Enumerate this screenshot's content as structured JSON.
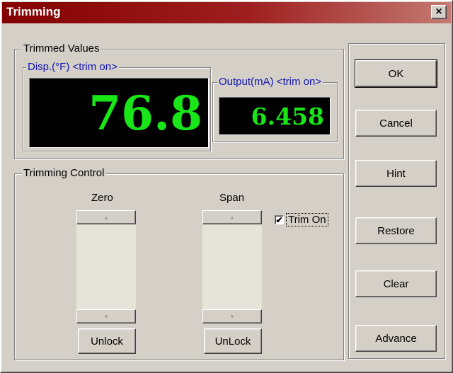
{
  "window": {
    "title": "Trimming",
    "close_glyph": "×"
  },
  "trimmed_values": {
    "legend": "Trimmed Values",
    "disp": {
      "legend": "Disp.(°F) <trim on>",
      "value": "76.8"
    },
    "output": {
      "legend": "Output(mA) <trim on>",
      "value": "6.458"
    }
  },
  "trimming_control": {
    "legend": "Trimming Control",
    "zero": {
      "label": "Zero",
      "unlock_label": "Unlock"
    },
    "span": {
      "label": "Span",
      "unlock_label": "UnLock"
    },
    "trim_on": {
      "label": "Trim On",
      "checked": true,
      "check_glyph": "✔"
    },
    "scroll_up_glyph": "▲",
    "scroll_down_glyph": "▼"
  },
  "buttons": {
    "ok": "OK",
    "cancel": "Cancel",
    "hint": "Hint",
    "restore": "Restore",
    "clear": "Clear",
    "advance": "Advance"
  },
  "colors": {
    "titlebar_start": "#840000",
    "titlebar_end": "#c47a72",
    "display_text": "#19e619",
    "display_bg": "#000000",
    "legend_blue": "#1414b4"
  },
  "icons": [
    "close-icon",
    "scroll-up-arrow-icon",
    "scroll-down-arrow-icon",
    "check-mark-icon"
  ]
}
